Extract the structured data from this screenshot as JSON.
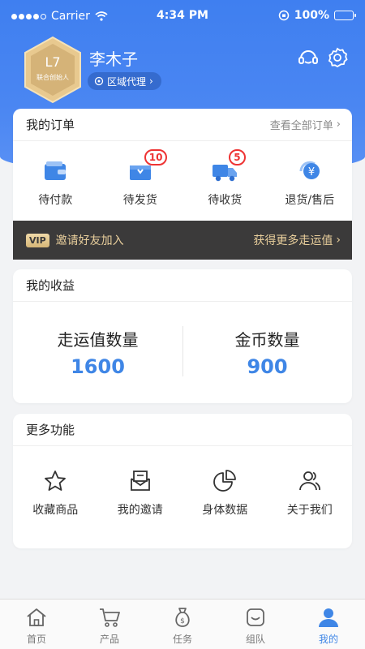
{
  "status_bar": {
    "carrier": "Carrier",
    "time": "4:34 PM",
    "battery": "100%"
  },
  "profile": {
    "level": "L7",
    "level_title": "联合创始人",
    "name": "李木子",
    "role": "区域代理"
  },
  "orders": {
    "title": "我的订单",
    "view_all": "查看全部订单",
    "items": [
      {
        "label": "待付款",
        "icon": "wallet-icon",
        "badge": ""
      },
      {
        "label": "待发货",
        "icon": "package-icon",
        "badge": "10"
      },
      {
        "label": "待收货",
        "icon": "truck-icon",
        "badge": "5"
      },
      {
        "label": "退货/售后",
        "icon": "refund-icon",
        "badge": ""
      }
    ]
  },
  "vip": {
    "tag": "VIP",
    "text": "邀请好友加入",
    "link": "获得更多走运值"
  },
  "earnings": {
    "title": "我的收益",
    "items": [
      {
        "label": "走运值数量",
        "value": "1600"
      },
      {
        "label": "金币数量",
        "value": "900"
      }
    ]
  },
  "features": {
    "title": "更多功能",
    "items": [
      {
        "label": "收藏商品",
        "icon": "star-icon"
      },
      {
        "label": "我的邀请",
        "icon": "invite-mail-icon"
      },
      {
        "label": "身体数据",
        "icon": "pie-chart-icon"
      },
      {
        "label": "关于我们",
        "icon": "users-icon"
      }
    ]
  },
  "tabbar": {
    "items": [
      {
        "label": "首页",
        "icon": "home-icon"
      },
      {
        "label": "产品",
        "icon": "cart-icon"
      },
      {
        "label": "任务",
        "icon": "money-bag-icon"
      },
      {
        "label": "组队",
        "icon": "team-icon"
      },
      {
        "label": "我的",
        "icon": "profile-icon"
      }
    ],
    "active_index": 4
  },
  "colors": {
    "primary": "#3f86e6",
    "header": "#4a86f2",
    "badge_red": "#e33333",
    "vip_bg": "#3b3a3a",
    "vip_gold": "#e9cf9c"
  }
}
